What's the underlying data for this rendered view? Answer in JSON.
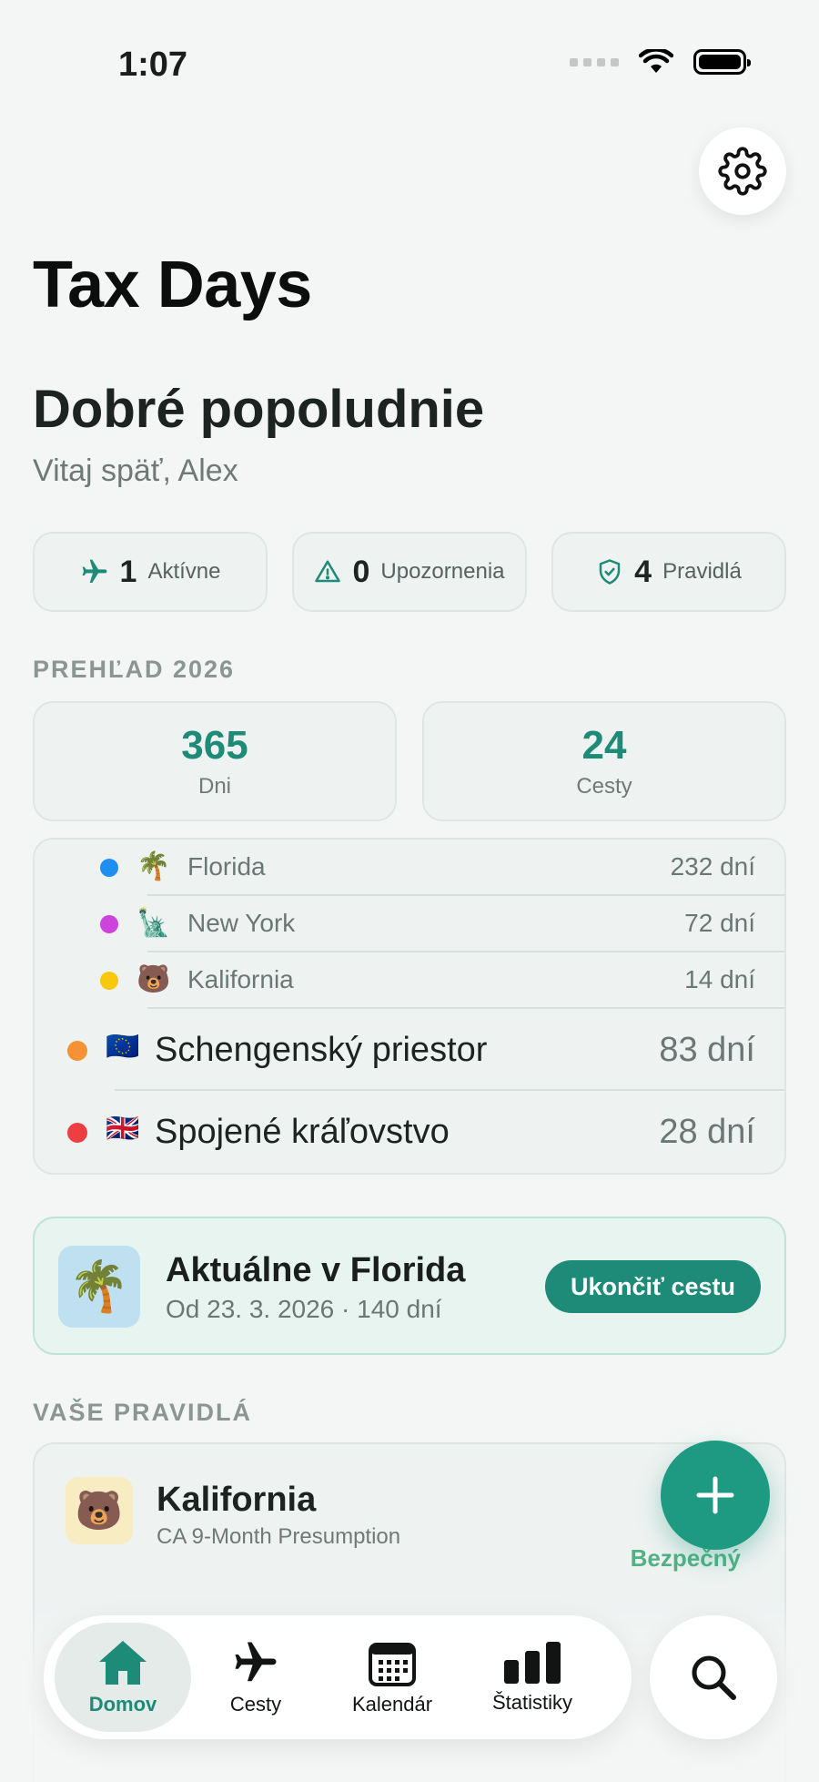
{
  "status_bar": {
    "time": "1:07"
  },
  "header": {
    "app_title": "Tax Days",
    "greeting": "Dobré popoludnie",
    "subgreeting": "Vitaj späť, Alex"
  },
  "chips": [
    {
      "icon": "airplane-icon",
      "count": "1",
      "label": "Aktívne"
    },
    {
      "icon": "warning-icon",
      "count": "0",
      "label": "Upozornenia"
    },
    {
      "icon": "shield-check-icon",
      "count": "4",
      "label": "Pravidlá"
    }
  ],
  "overview": {
    "label": "PREHĽAD 2026",
    "stats": [
      {
        "value": "365",
        "label": "Dni"
      },
      {
        "value": "24",
        "label": "Cesty"
      }
    ],
    "sub_regions": [
      {
        "emoji": "🌴",
        "name": "Florida",
        "days": "232 dní",
        "color": "#1f8ef1"
      },
      {
        "emoji": "🗽",
        "name": "New York",
        "days": "72 dní",
        "color": "#cc44dd"
      },
      {
        "emoji": "🐻",
        "name": "Kalifornia",
        "days": "14 dní",
        "color": "#f7c80b"
      }
    ],
    "regions": [
      {
        "emoji": "🇪🇺",
        "name": "Schengenský priestor",
        "days": "83 dní",
        "color": "#f59233"
      },
      {
        "emoji": "🇬🇧",
        "name": "Spojené kráľovstvo",
        "days": "28 dní",
        "color": "#ef3e42"
      }
    ]
  },
  "current": {
    "emoji": "🌴",
    "title": "Aktuálne v Florida",
    "meta": "Od 23. 3. 2026 · 140 dní",
    "end_label": "Ukončiť cestu"
  },
  "rules": {
    "label": "VAŠE PRAVIDLÁ",
    "items": [
      {
        "emoji": "🐻",
        "title": "Kalifornia",
        "subtitle": "CA 9-Month Presumption",
        "status": "Bezpečný"
      }
    ]
  },
  "tabbar": {
    "tabs": [
      {
        "icon": "home-icon",
        "label": "Domov",
        "active": true
      },
      {
        "icon": "airplane-icon",
        "label": "Cesty"
      },
      {
        "icon": "calendar-icon",
        "label": "Kalendár"
      },
      {
        "icon": "bar-chart-icon",
        "label": "Štatistiky"
      }
    ]
  },
  "colors": {
    "accent": "#1e8a78",
    "background": "#f4f6f5",
    "safe": "#52b085"
  }
}
